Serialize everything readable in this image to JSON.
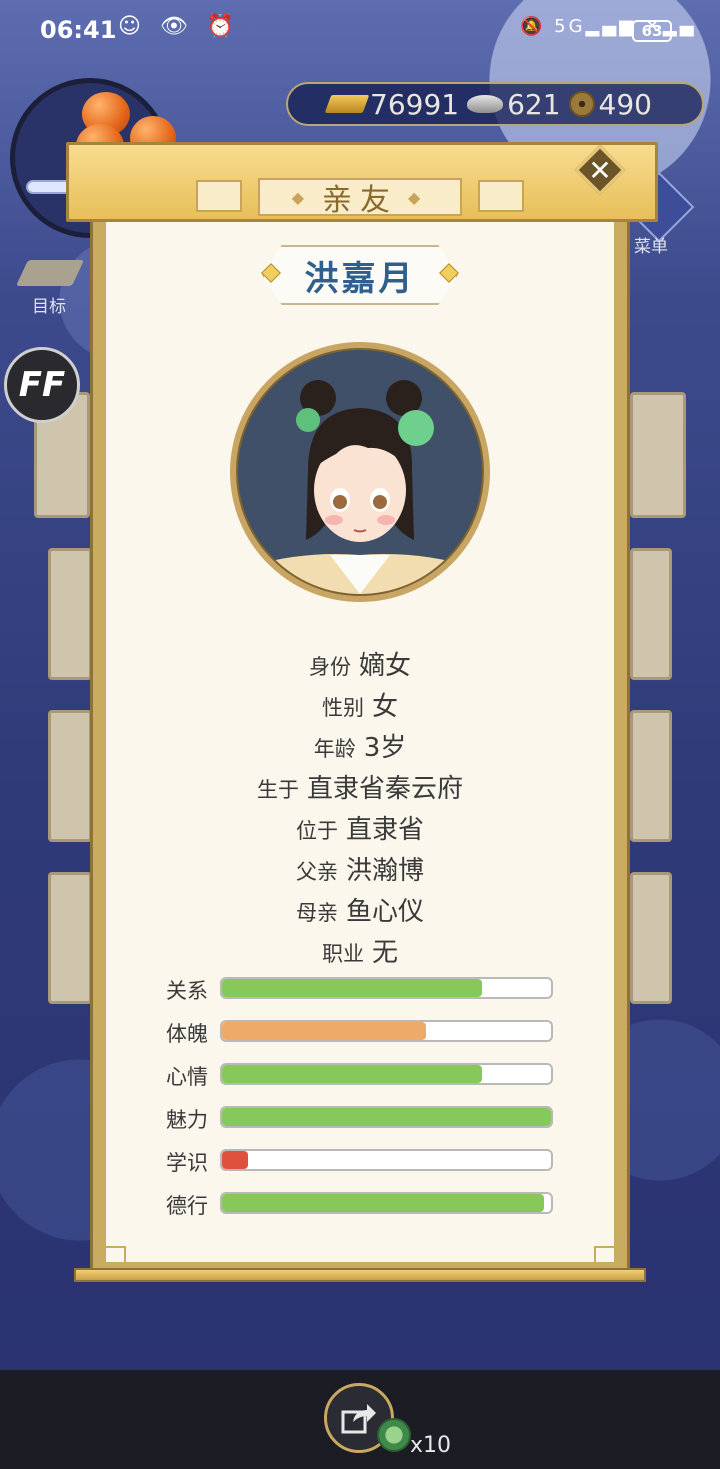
{
  "status_bar": {
    "time": "06:41",
    "signal_text": "5G",
    "battery": "63"
  },
  "currency": {
    "gold": "76991",
    "silver": "621",
    "copper": "490"
  },
  "side": {
    "goal_label": "目标",
    "menu_label": "菜单",
    "ff_label": "FF"
  },
  "dialog": {
    "title": "亲友",
    "close_symbol": "✕",
    "name": "洪嘉月",
    "info": [
      {
        "label": "身份",
        "value": "嫡女"
      },
      {
        "label": "性别",
        "value": "女"
      },
      {
        "label": "年龄",
        "value": "3岁"
      },
      {
        "label": "生于",
        "value": "直隶省秦云府"
      },
      {
        "label": "位于",
        "value": "直隶省"
      },
      {
        "label": "父亲",
        "value": "洪瀚博"
      },
      {
        "label": "母亲",
        "value": "鱼心仪"
      },
      {
        "label": "职业",
        "value": "无"
      }
    ],
    "stats": [
      {
        "label": "关系",
        "value": 0.79,
        "color": "#86c85a"
      },
      {
        "label": "体魄",
        "value": 0.62,
        "color": "#eeaa68"
      },
      {
        "label": "心情",
        "value": 0.79,
        "color": "#86c85a"
      },
      {
        "label": "魅力",
        "value": 1.0,
        "color": "#86c85a"
      },
      {
        "label": "学识",
        "value": 0.08,
        "color": "#e0513d"
      },
      {
        "label": "德行",
        "value": 0.98,
        "color": "#86c85a"
      }
    ]
  },
  "bottom": {
    "share_count": "x10"
  },
  "colors": {
    "accent_gold": "#c9ab62",
    "name_blue": "#2f5f8e",
    "background_blue": "#2b3468"
  }
}
